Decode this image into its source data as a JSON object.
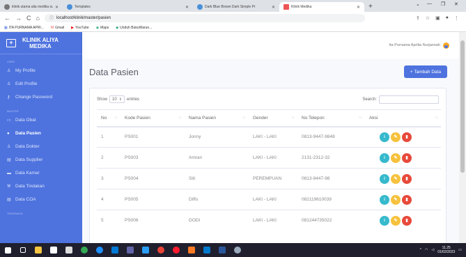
{
  "browser": {
    "tabs": [
      {
        "label": "klinik utama alia medika susato"
      },
      {
        "label": "Templates"
      },
      {
        "label": "Dark Blue Brown Dark Simple Pr"
      },
      {
        "label": "Klinik Medika"
      }
    ],
    "new_tab": "+",
    "url": "localhost/klinik/master/pasien",
    "bookmarks": [
      "ITA PURNAMA APRI...",
      "Gmail",
      "YouTube",
      "Maps",
      "Unduh BukuWarun..."
    ]
  },
  "brand": {
    "line1": "KLINIK ALIYA",
    "line2": "MEDIKA",
    "logo": "+"
  },
  "sidebar": {
    "sections": [
      {
        "label": "USER",
        "items": [
          {
            "label": "My Profile",
            "icon": "user-icon"
          },
          {
            "label": "Edit Profile",
            "icon": "user-edit-icon"
          },
          {
            "label": "Change Password",
            "icon": "key-icon"
          }
        ]
      },
      {
        "label": "MASTER",
        "items": [
          {
            "label": "Data Obat",
            "icon": "pills-icon"
          },
          {
            "label": "Data Pasien",
            "icon": "users-icon",
            "active": true
          },
          {
            "label": "Data Dokter",
            "icon": "doctor-icon"
          },
          {
            "label": "Data Supplier",
            "icon": "list-icon"
          },
          {
            "label": "Data Kamar",
            "icon": "bed-icon"
          },
          {
            "label": "Data Tindakan",
            "icon": "tools-icon"
          },
          {
            "label": "Data COA",
            "icon": "list-icon"
          }
        ]
      },
      {
        "label": "TRANSAKSI",
        "items": []
      }
    ]
  },
  "topbar": {
    "user_name": "Ita Purnama Aprilia Nurjannah"
  },
  "page": {
    "title": "Data Pasien",
    "add_button": "+ Tambah Data"
  },
  "table_controls": {
    "show_label": "Show",
    "entries_value": "10",
    "entries_label": "entries",
    "search_label": "Search:"
  },
  "table": {
    "columns": [
      "No",
      "Kode Pasien",
      "Nama Pasien",
      "Gender",
      "No Telepon",
      "Aksi"
    ],
    "rows": [
      {
        "no": "1",
        "kode": "PS001",
        "nama": "Jonny",
        "gender": "LAKI - LAKI",
        "telp": "0813-9447-9848"
      },
      {
        "no": "2",
        "kode": "PS003",
        "nama": "Amran",
        "gender": "LAKI - LAKI",
        "telp": "2131-2312-32"
      },
      {
        "no": "3",
        "kode": "PS004",
        "nama": "Siti",
        "gender": "PEREMPUAN",
        "telp": "0813-9447-98"
      },
      {
        "no": "4",
        "kode": "PS005",
        "nama": "Diffo",
        "gender": "LAKI - LAKI",
        "telp": "082119610039"
      },
      {
        "no": "5",
        "kode": "PS006",
        "nama": "DODI",
        "gender": "LAKI - LAKI",
        "telp": "081244735022"
      }
    ]
  },
  "clock": {
    "time": "11.25",
    "date": "01/02/2023"
  },
  "colors": {
    "primary": "#4e73df",
    "info": "#36b9cc",
    "warning": "#f6c23e",
    "danger": "#e74a3b"
  }
}
